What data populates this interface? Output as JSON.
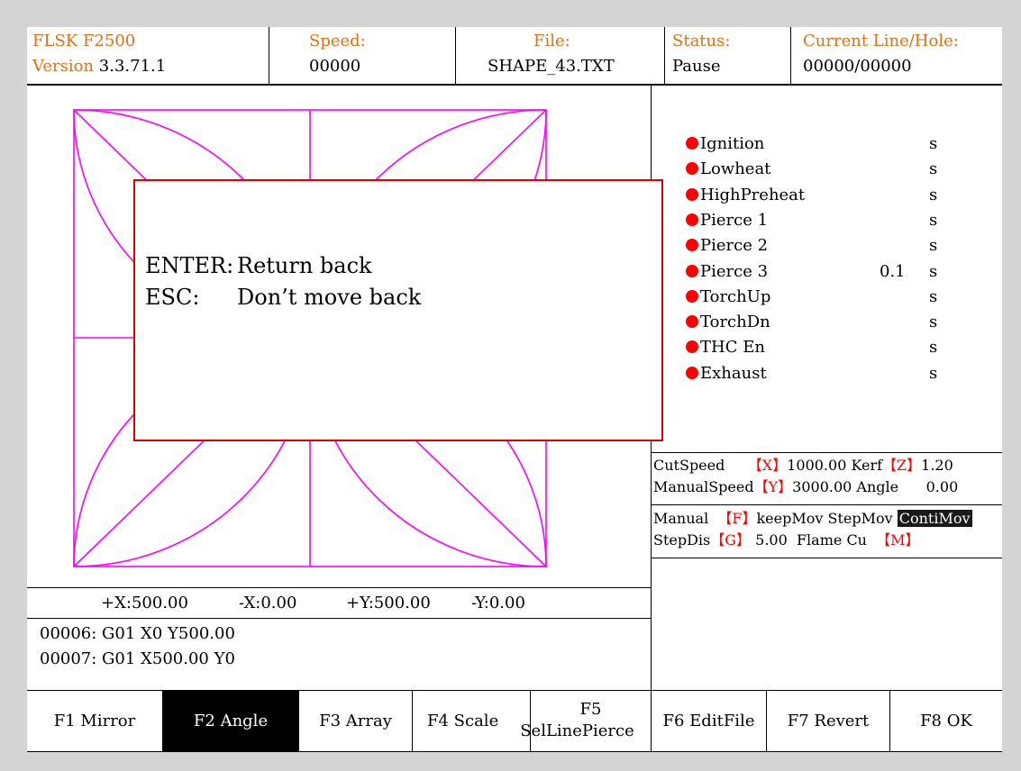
{
  "header": {
    "product": "FLSK F2500",
    "version_label": "Version",
    "version": "3.3.71.1",
    "speed_label": "Speed:",
    "speed": "00000",
    "file_label": "File:",
    "file": "SHAPE_43.TXT",
    "status_label": "Status:",
    "status": "Pause",
    "line_label": "Current Line/Hole:",
    "line": "00000/00000"
  },
  "io": [
    {
      "label": "Ignition",
      "value": "",
      "unit": "s"
    },
    {
      "label": "Lowheat",
      "value": "",
      "unit": "s"
    },
    {
      "label": "HighPreheat",
      "value": "",
      "unit": "s"
    },
    {
      "label": "Pierce 1",
      "value": "",
      "unit": "s"
    },
    {
      "label": "Pierce 2",
      "value": "",
      "unit": "s"
    },
    {
      "label": "Pierce 3",
      "value": "0.1",
      "unit": "s"
    },
    {
      "label": "TorchUp",
      "value": "",
      "unit": "s"
    },
    {
      "label": "TorchDn",
      "value": "",
      "unit": "s"
    },
    {
      "label": "THC En",
      "value": "",
      "unit": "s"
    },
    {
      "label": "Exhaust",
      "value": "",
      "unit": "s"
    }
  ],
  "params": {
    "cut_speed_label": "CutSpeed",
    "key_x": "【X】",
    "cut_speed": "1000.00",
    "kerf_label": "Kerf",
    "key_z": "【Z】",
    "kerf": "1.20",
    "manual_speed_label": "ManualSpeed",
    "key_y": "【Y】",
    "manual_speed": "3000.00",
    "angle_label": "Angle",
    "angle": "0.00",
    "manual_label": "Manual",
    "key_f": "【F】",
    "keep_mov": "keepMov",
    "step_mov": "StepMov",
    "conti_mov": "ContiMov",
    "step_dis_label": "StepDis",
    "key_g": "【G】",
    "step_dis": "5.00",
    "flame_label": "Flame Cu",
    "key_m": "【M】"
  },
  "limits": {
    "px": "+X:500.00",
    "nx": "-X:0.00",
    "py": "+Y:500.00",
    "ny": "-Y:0.00"
  },
  "gcode": [
    "00006: G01 X0 Y500.00",
    "00007: G01 X500.00 Y0"
  ],
  "dialog": {
    "line1_key": "ENTER:",
    "line1_text": "Return back",
    "line2_key": "ESC:",
    "line2_text": "Don’t move back"
  },
  "fkeys": [
    {
      "label": "F1 Mirror"
    },
    {
      "label": "F2 Angle"
    },
    {
      "label": "F3 Array"
    },
    {
      "label": "F4 Scale"
    },
    {
      "label_top": "F5",
      "label_bottom": "SelLinePierce"
    },
    {
      "label": "F6 EditFile"
    },
    {
      "label": "F7 Revert"
    },
    {
      "label": "F8 OK"
    }
  ],
  "colors": {
    "shape_stroke": "#ff00ff",
    "accent": "#e0701a",
    "indicator": "#ff0000"
  },
  "icons": {
    "io_status": "filled-red-circle"
  }
}
